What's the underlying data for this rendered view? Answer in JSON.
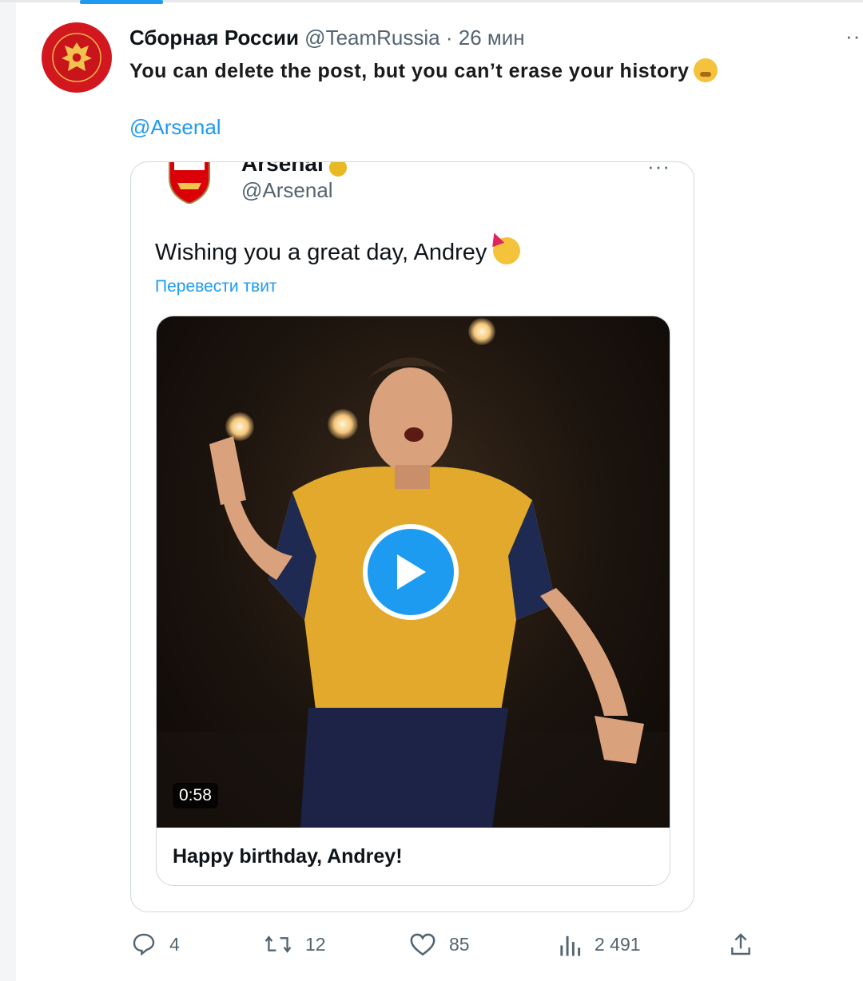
{
  "tweet": {
    "author_name": "Сборная России",
    "author_handle": "@TeamRussia",
    "separator": "·",
    "time": "26 мин",
    "text": "You can delete the post, but you can’t erase your history",
    "emoji": "shushing-face",
    "mention": "@Arsenal"
  },
  "quoted_tweet": {
    "author_name": "Arsenal",
    "author_handle": "@Arsenal",
    "text": "Wishing you a great day, Andrey",
    "emoji": "partying-face",
    "translate_link": "Перевести твит",
    "video": {
      "duration": "0:58",
      "caption": "Happy birthday, Andrey!"
    }
  },
  "actions": {
    "replies": "4",
    "retweets": "12",
    "likes": "85",
    "views": "2 491"
  },
  "colors": {
    "accent": "#1d9bf0",
    "avatar_red": "#d3171f",
    "muted_text": "#536471"
  }
}
